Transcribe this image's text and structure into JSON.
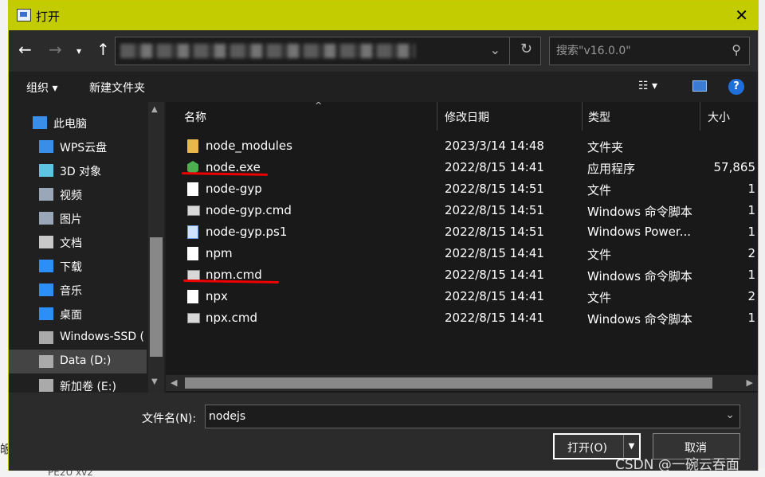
{
  "window": {
    "title": "打开"
  },
  "background": {
    "left_text": "皈",
    "bottom_text": "PE2U xv2"
  },
  "nav": {
    "back_icon": "arrow-left-icon",
    "forward_icon": "arrow-right-icon",
    "recent_icon": "chevron-down-icon",
    "up_icon": "arrow-up-icon",
    "search_placeholder": "搜索\"v16.0.0\""
  },
  "toolbar": {
    "organize_label": "组织 ▾",
    "new_folder_label": "新建文件夹",
    "view_label": "☷ ▾",
    "help_label": "?"
  },
  "sidebar": {
    "items": [
      {
        "label": "此电脑",
        "icon": "computer-icon",
        "color": "#3a8ee6"
      },
      {
        "label": "WPS云盘",
        "icon": "cloud-icon",
        "color": "#3a8ee6"
      },
      {
        "label": "3D 对象",
        "icon": "cube-3d-icon",
        "color": "#5fc3e4"
      },
      {
        "label": "视频",
        "icon": "video-icon",
        "color": "#9aa7b8"
      },
      {
        "label": "图片",
        "icon": "pictures-icon",
        "color": "#9aa7b8"
      },
      {
        "label": "文档",
        "icon": "documents-icon",
        "color": "#c8c8c8"
      },
      {
        "label": "下载",
        "icon": "download-icon",
        "color": "#2d8ef5"
      },
      {
        "label": "音乐",
        "icon": "music-icon",
        "color": "#2d8ef5"
      },
      {
        "label": "桌面",
        "icon": "desktop-icon",
        "color": "#2d8ef5"
      },
      {
        "label": "Windows-SSD (",
        "icon": "drive-windows-icon",
        "color": "#aaaaaa"
      },
      {
        "label": "Data (D:)",
        "icon": "drive-icon",
        "color": "#aaaaaa"
      },
      {
        "label": "新加卷 (E:)",
        "icon": "drive-icon",
        "color": "#aaaaaa"
      }
    ]
  },
  "columns": {
    "name": "名称",
    "date": "修改日期",
    "type": "类型",
    "size": "大小"
  },
  "files": [
    {
      "name": "node_modules",
      "date": "2023/3/14 14:48",
      "type": "文件夹",
      "size": "",
      "icon": "folder-icon"
    },
    {
      "name": "node.exe",
      "date": "2022/8/15 14:41",
      "type": "应用程序",
      "size": "57,865",
      "icon": "node-exe-icon"
    },
    {
      "name": "node-gyp",
      "date": "2022/8/15 14:51",
      "type": "文件",
      "size": "1",
      "icon": "file-icon"
    },
    {
      "name": "node-gyp.cmd",
      "date": "2022/8/15 14:51",
      "type": "Windows 命令脚本",
      "size": "1",
      "icon": "cmd-script-icon"
    },
    {
      "name": "node-gyp.ps1",
      "date": "2022/8/15 14:51",
      "type": "Windows Power...",
      "size": "1",
      "icon": "powershell-script-icon"
    },
    {
      "name": "npm",
      "date": "2022/8/15 14:41",
      "type": "文件",
      "size": "2",
      "icon": "file-icon"
    },
    {
      "name": "npm.cmd",
      "date": "2022/8/15 14:41",
      "type": "Windows 命令脚本",
      "size": "1",
      "icon": "cmd-script-icon"
    },
    {
      "name": "npx",
      "date": "2022/8/15 14:41",
      "type": "文件",
      "size": "2",
      "icon": "file-icon"
    },
    {
      "name": "npx.cmd",
      "date": "2022/8/15 14:41",
      "type": "Windows 命令脚本",
      "size": "1",
      "icon": "cmd-script-icon"
    }
  ],
  "bottom": {
    "filename_label": "文件名(N):",
    "filename_value": "nodejs",
    "open_label": "打开(O)",
    "cancel_label": "取消"
  },
  "watermark": "CSDN @一碗云吞面",
  "colors": {
    "titlebar": "#c3cc00",
    "annotation": "#e00000"
  }
}
